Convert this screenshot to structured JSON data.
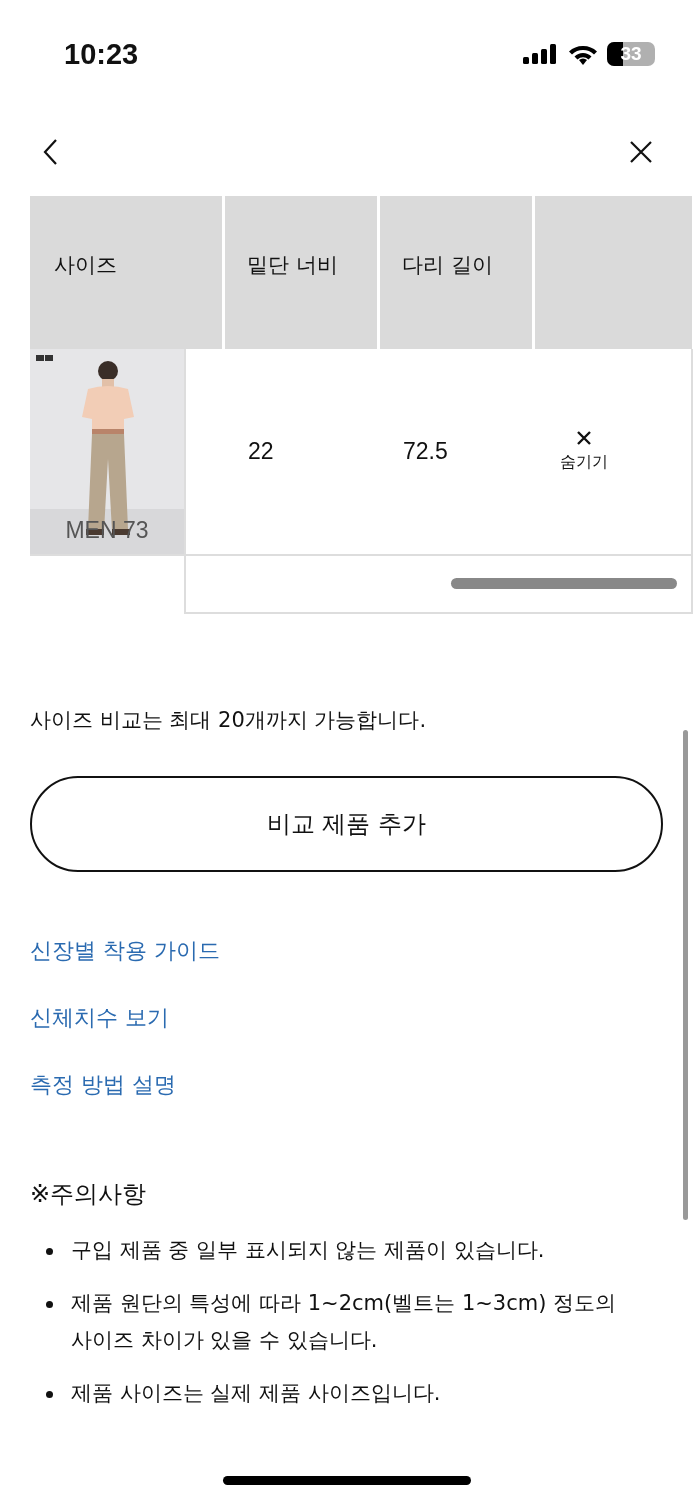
{
  "status_bar": {
    "time": "10:23",
    "battery": "33"
  },
  "table": {
    "columns": [
      "사이즈",
      "밑단 너비",
      "다리 길이"
    ],
    "rows": [
      {
        "cells": [
          {
            "kind": "picture",
            "caption": "MEN 73"
          },
          {
            "kind": "text",
            "text": "22"
          },
          {
            "kind": "text",
            "text": "72.5"
          },
          {
            "kind": "hide",
            "text": "숨기기"
          }
        ]
      }
    ]
  },
  "note": "사이즈 비교는 최대 20개까지 가능합니다.",
  "add_button": "비교 제품 추가",
  "links": [
    "신장별 착용 가이드",
    "신체치수 보기",
    "측정 방법 설명"
  ],
  "caution": {
    "title": "※주의사항",
    "items": [
      "구입 제품 중 일부 표시되지 않는 제품이 있습니다.",
      "제품 원단의 특성에 따라 1~2cm(벨트는 1~3cm) 정도의 사이즈 차이가 있을 수 있습니다.",
      "제품 사이즈는 실제 제품 사이즈입니다."
    ]
  }
}
